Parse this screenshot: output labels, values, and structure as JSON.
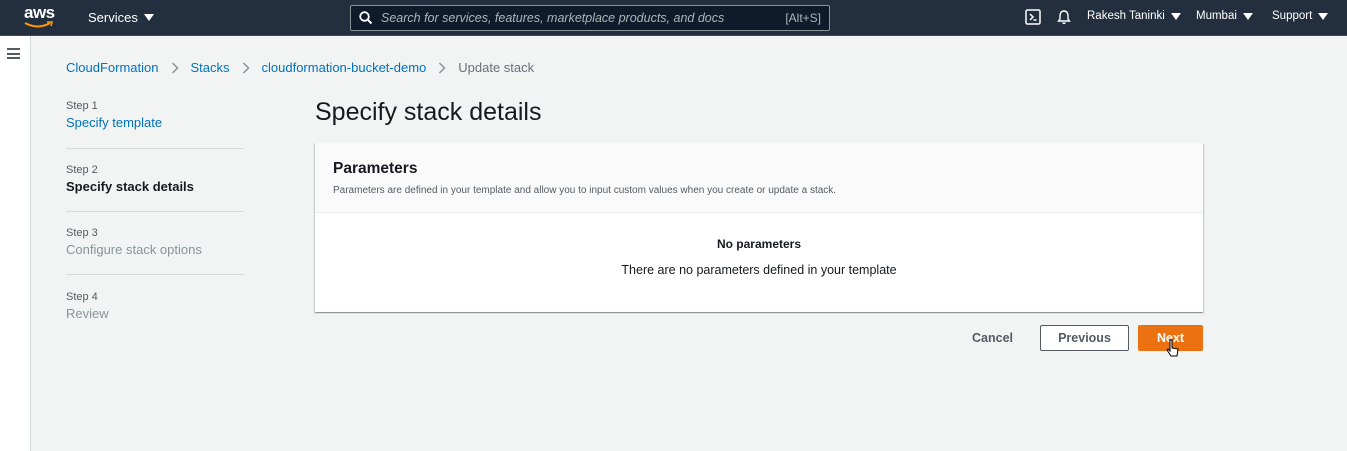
{
  "nav": {
    "logo_text": "aws",
    "services_label": "Services",
    "search_placeholder": "Search for services, features, marketplace products, and docs",
    "search_shortcut": "[Alt+S]",
    "user_label": "Rakesh Taninki",
    "region_label": "Mumbai",
    "support_label": "Support"
  },
  "breadcrumb": {
    "items": [
      "CloudFormation",
      "Stacks",
      "cloudformation-bucket-demo"
    ],
    "current": "Update stack"
  },
  "steps": [
    {
      "num": "Step 1",
      "title": "Specify template",
      "state": "link"
    },
    {
      "num": "Step 2",
      "title": "Specify stack details",
      "state": "active"
    },
    {
      "num": "Step 3",
      "title": "Configure stack options",
      "state": "disabled"
    },
    {
      "num": "Step 4",
      "title": "Review",
      "state": "disabled"
    }
  ],
  "main": {
    "title": "Specify stack details",
    "panel": {
      "title": "Parameters",
      "description": "Parameters are defined in your template and allow you to input custom values when you create or update a stack.",
      "empty_title": "No parameters",
      "empty_description": "There are no parameters defined in your template"
    }
  },
  "actions": {
    "cancel_label": "Cancel",
    "previous_label": "Previous",
    "next_label": "Next"
  },
  "colors": {
    "nav_bg": "#232f3e",
    "link": "#0073bb",
    "primary": "#ec7211",
    "aws_orange": "#ff9900"
  },
  "icons": [
    "search-icon",
    "cloudshell-icon",
    "bell-icon",
    "hamburger-icon",
    "chevron-right-icon",
    "cursor-icon"
  ]
}
